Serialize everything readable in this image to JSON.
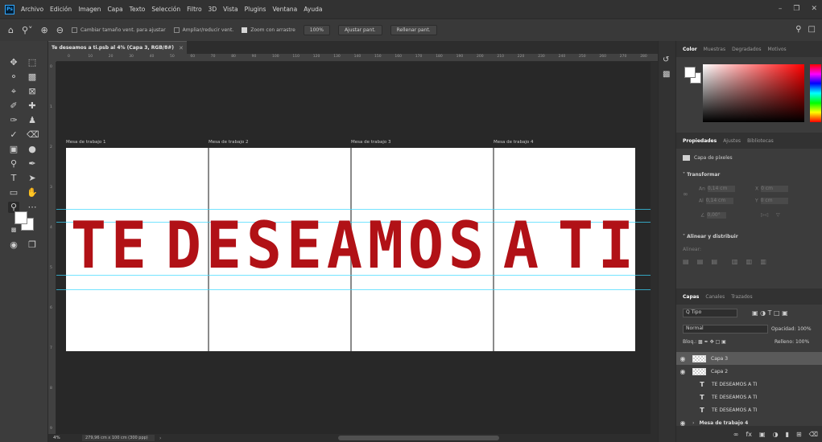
{
  "app": {
    "logo": "Ps"
  },
  "menu": [
    "Archivo",
    "Edición",
    "Imagen",
    "Capa",
    "Texto",
    "Selección",
    "Filtro",
    "3D",
    "Vista",
    "Plugins",
    "Ventana",
    "Ayuda"
  ],
  "options": {
    "resize_windows": "Cambiar tamaño vent. para ajustar",
    "zoom_all": "Ampliar/reducir vent.",
    "scrubby_zoom": "Zoom con arrastre",
    "zoom_percent": "100%",
    "fit_screen": "Ajustar pant.",
    "fill_screen": "Rellenar pant."
  },
  "document": {
    "tab_title": "Te deseamos a ti.psb al 4% (Capa 3, RGB/8#)",
    "zoom": "4%",
    "doc_size": "279,96 cm x 100 cm (300 ppp)"
  },
  "ruler": {
    "top": [
      "0",
      "10",
      "20",
      "30",
      "40",
      "50",
      "60",
      "70",
      "80",
      "90",
      "100",
      "110",
      "120",
      "130",
      "140",
      "150",
      "160",
      "170",
      "180",
      "190",
      "200",
      "210",
      "220",
      "230",
      "240",
      "250",
      "260",
      "270",
      "280"
    ],
    "left": [
      "0",
      "1",
      "2",
      "3",
      "4",
      "5",
      "6",
      "7",
      "8",
      "9"
    ]
  },
  "artboards": [
    "Mesa de trabajo 1",
    "Mesa de trabajo 2",
    "Mesa de trabajo 3",
    "Mesa de trabajo 4"
  ],
  "banner": {
    "text": "TE DESEAMOS A TI",
    "color": "#b11116"
  },
  "color_panel": {
    "tabs": [
      "Color",
      "Muestras",
      "Degradados",
      "Motivos"
    ]
  },
  "properties": {
    "tabs": [
      "Propiedades",
      "Ajustes",
      "Bibliotecas"
    ],
    "layer_kind": "Capa de píxeles",
    "transform_header": "Transformar",
    "w_label": "An",
    "h_label": "Al",
    "x_label": "X",
    "y_label": "Y",
    "w_value": "0,14 cm",
    "h_value": "0,14 cm",
    "x_value": "0 cm",
    "y_value": "0 cm",
    "angle_value": "0,00°",
    "align_header": "Alinear y distribuir",
    "align_label": "Alinear:"
  },
  "layers": {
    "tabs": [
      "Capas",
      "Canales",
      "Trazados"
    ],
    "filter": "Q Tipo",
    "blend_mode": "Normal",
    "opacity_label": "Opacidad:",
    "opacity_value": "100%",
    "lock_label": "Bloq.:",
    "fill_label": "Relleno:",
    "fill_value": "100%",
    "items": [
      {
        "name": "Capa 3",
        "type": "pixel",
        "visible": true,
        "selected": true
      },
      {
        "name": "Capa 2",
        "type": "pixel",
        "visible": true,
        "selected": false
      },
      {
        "name": "TE DESEAMOS A TI",
        "type": "text",
        "visible": false,
        "selected": false
      },
      {
        "name": "TE DESEAMOS A TI",
        "type": "text",
        "visible": false,
        "selected": false
      },
      {
        "name": "TE DESEAMOS A TI",
        "type": "text",
        "visible": false,
        "selected": false
      },
      {
        "name": "Mesa de trabajo 4",
        "type": "artboard",
        "visible": true,
        "selected": false
      }
    ]
  }
}
